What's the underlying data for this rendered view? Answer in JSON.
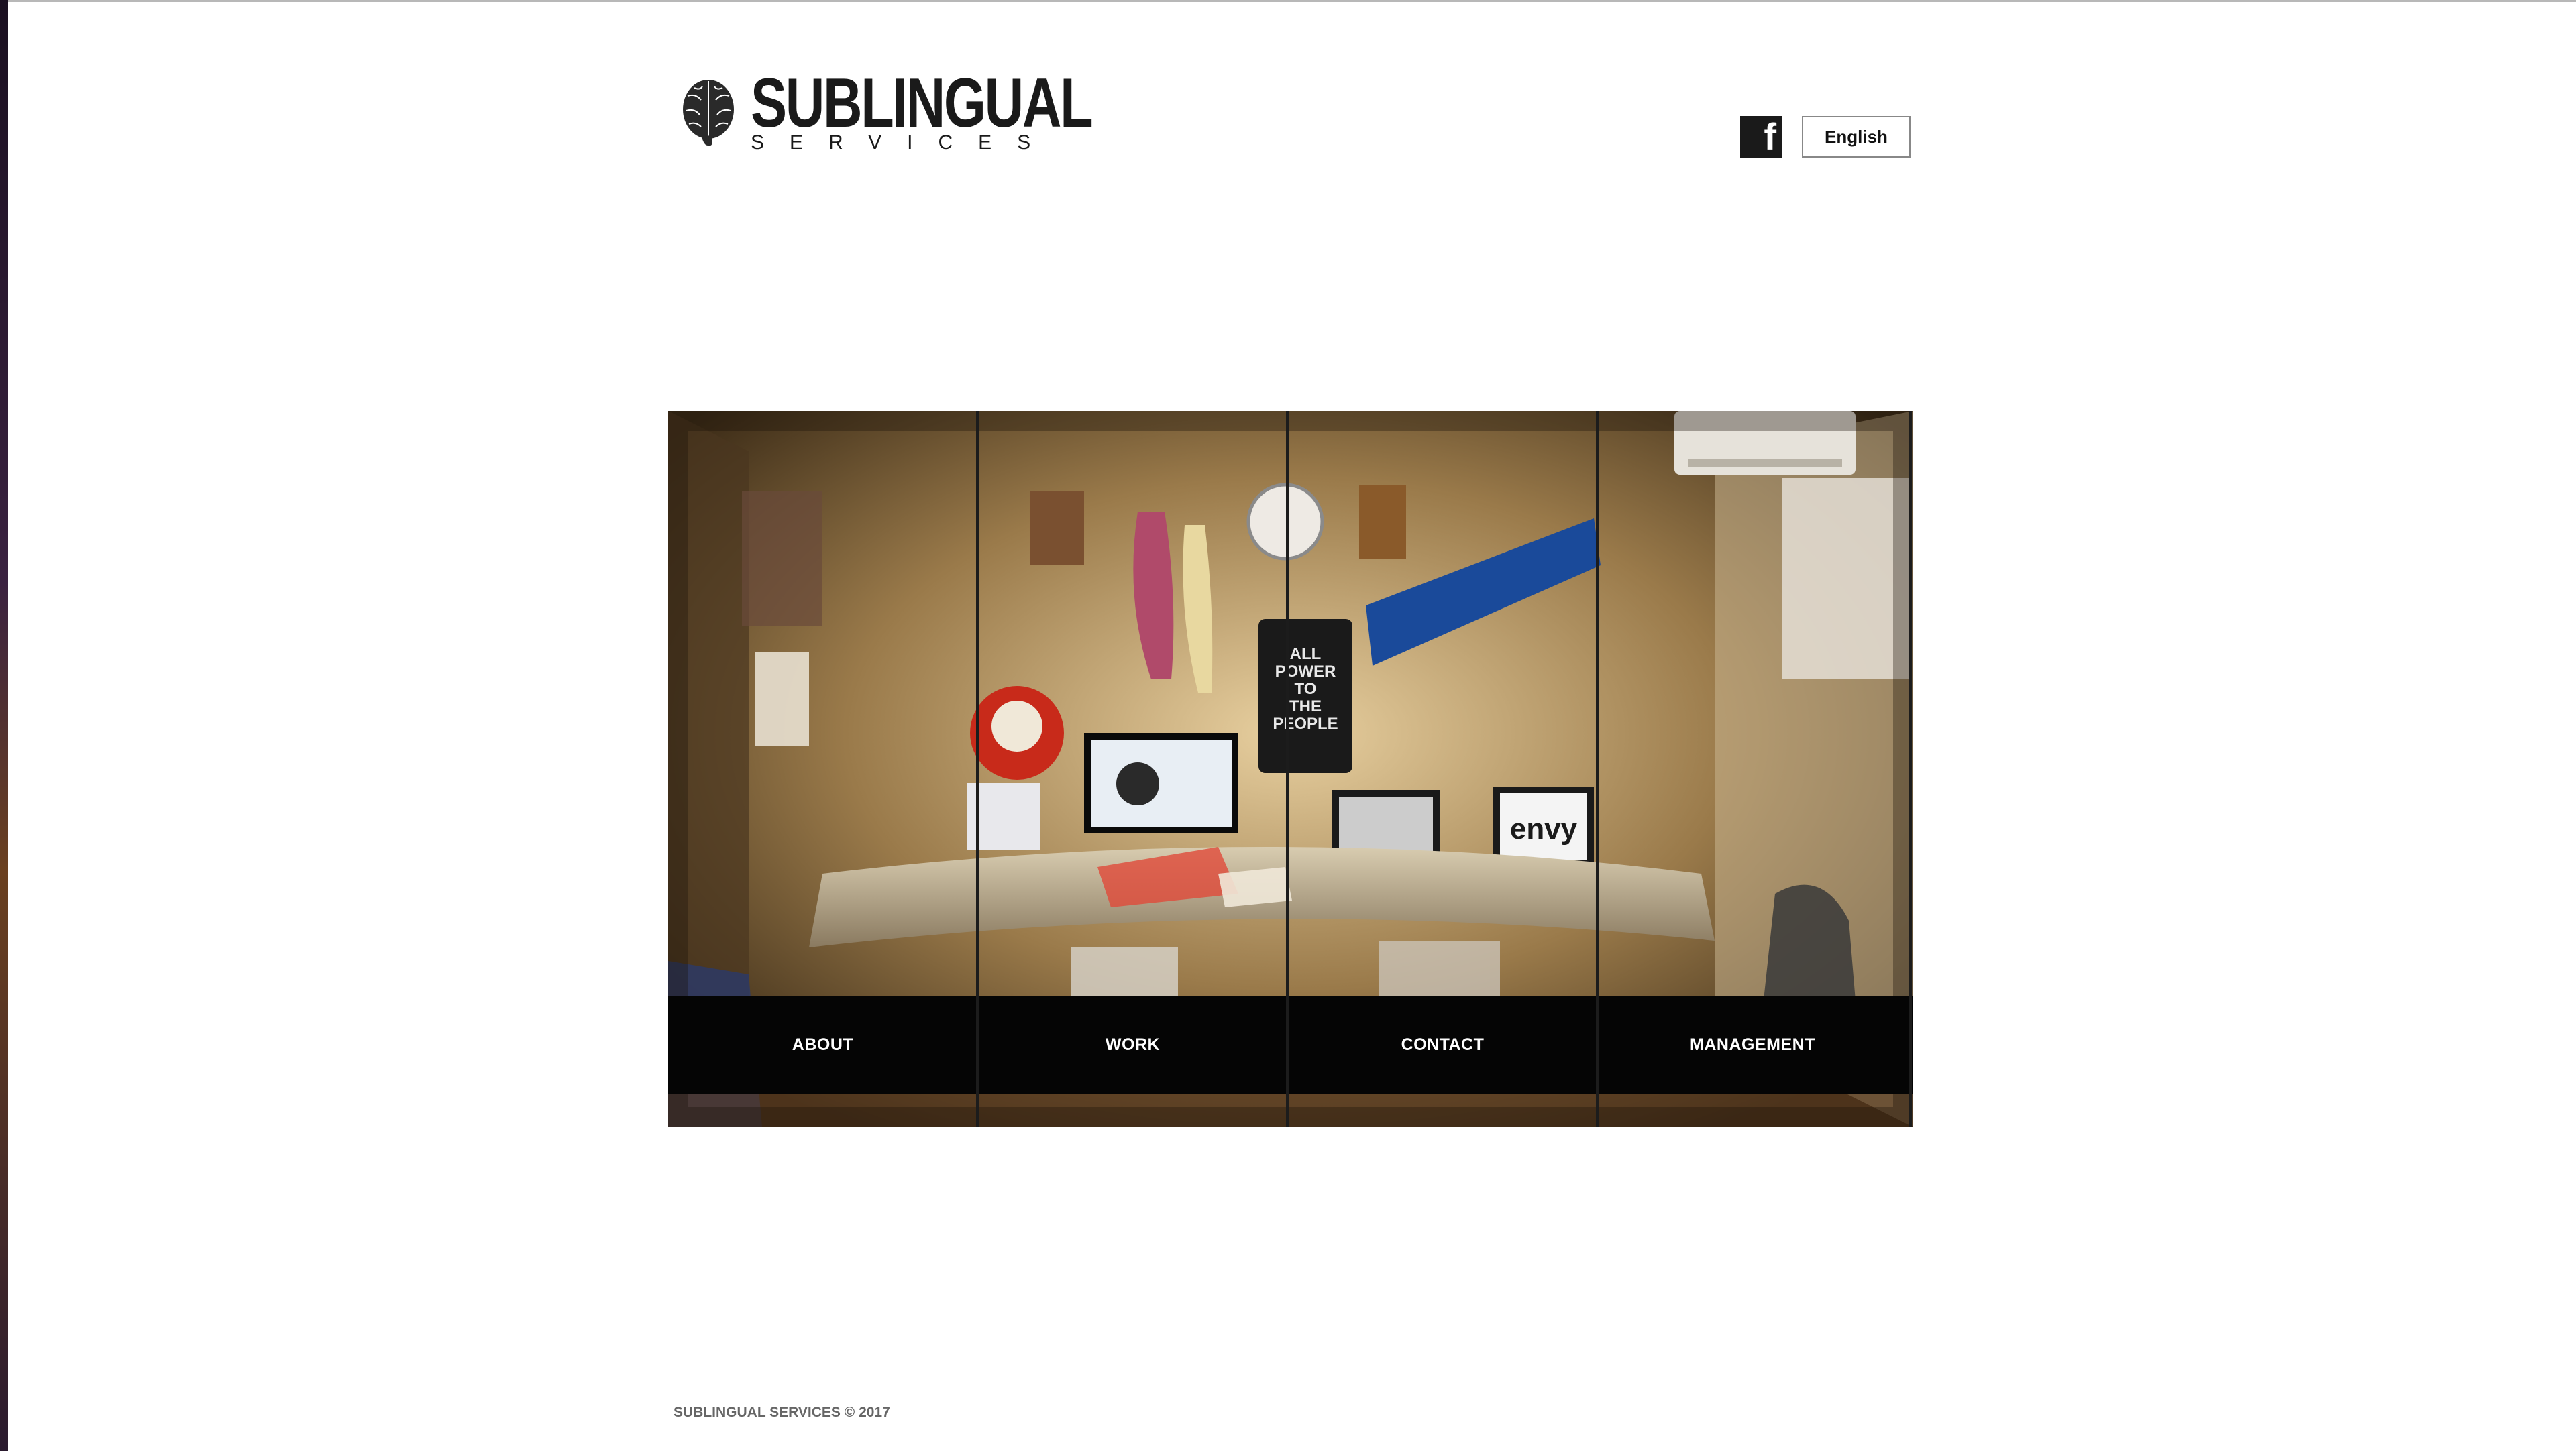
{
  "header": {
    "logo_title": "SUBLINGUAL",
    "logo_subtitle": "SERVICES",
    "facebook_icon": "facebook-icon",
    "facebook_glyph": "f",
    "language_label": "English"
  },
  "hero": {
    "photo_caption_texts": [
      "ALL POWER TO THE PEOPLE",
      "envy"
    ]
  },
  "nav": {
    "items": [
      {
        "label": "ABOUT"
      },
      {
        "label": "WORK"
      },
      {
        "label": "CONTACT"
      },
      {
        "label": "MANAGEMENT"
      }
    ]
  },
  "footer": {
    "copyright": "SUBLINGUAL SERVICES © 2017"
  },
  "colors": {
    "background": "#ffffff",
    "nav_bar": "#050505",
    "text_dark": "#1a1a1a",
    "footer_text": "#666666"
  }
}
